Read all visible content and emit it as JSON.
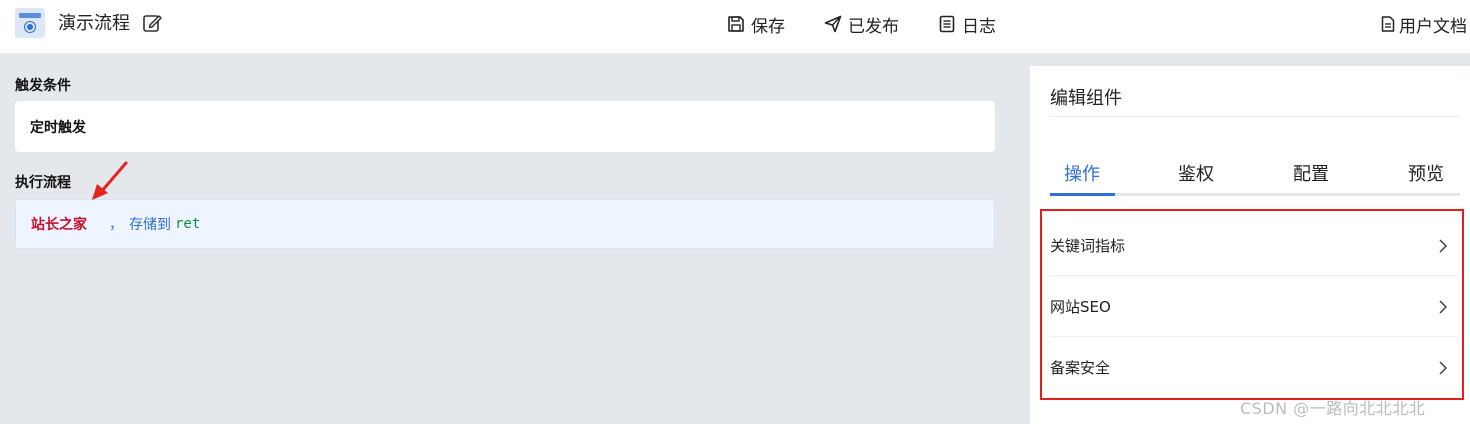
{
  "app": {
    "title": "演示流程",
    "icon": "workflow-app-icon",
    "edit_icon": "edit-icon"
  },
  "toolbar": {
    "save_label": "保存",
    "publish_label": "已发布",
    "log_label": "日志",
    "docs_label": "用户文档"
  },
  "trigger": {
    "section_label": "触发条件",
    "value": "定时触发"
  },
  "flow": {
    "section_label": "执行流程",
    "step_name": "站长之家",
    "separator": "，",
    "store_text": "存储到",
    "variable": "ret"
  },
  "panel": {
    "title": "编辑组件",
    "tabs": [
      {
        "label": "操作",
        "active": true
      },
      {
        "label": "鉴权",
        "active": false
      },
      {
        "label": "配置",
        "active": false
      },
      {
        "label": "预览",
        "active": false
      }
    ],
    "items": [
      {
        "label": "关键词指标"
      },
      {
        "label": "网站SEO"
      },
      {
        "label": "备案安全"
      }
    ]
  },
  "watermark": "CSDN @一路向北北北北",
  "colors": {
    "accent": "#2f6fd8",
    "highlight_box": "#e0201c",
    "step_name": "#c8102e",
    "variable": "#0a8f3c",
    "background": "#e4e7ec"
  }
}
